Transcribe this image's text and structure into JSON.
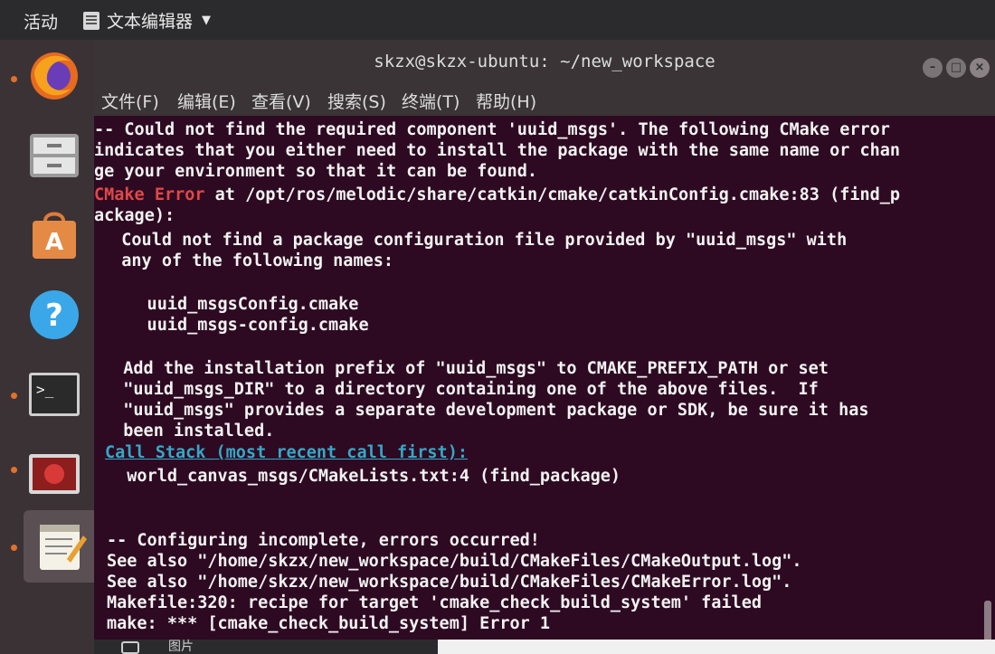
{
  "topbar": {
    "activities": "活动",
    "app_name": "文本编辑器",
    "app_icon": "text-editor-icon",
    "caret_icon": "chevron-down-icon"
  },
  "dock": {
    "items": [
      {
        "name": "firefox",
        "icon": "firefox-icon"
      },
      {
        "name": "files",
        "icon": "file-cabinet-icon"
      },
      {
        "name": "software",
        "icon": "shopping-bag-icon"
      },
      {
        "name": "help",
        "icon": "help-icon"
      },
      {
        "name": "terminal",
        "icon": "terminal-icon"
      },
      {
        "name": "screen-recorder",
        "icon": "red-record-icon"
      },
      {
        "name": "text-editor",
        "icon": "notepad-icon"
      }
    ]
  },
  "terminal": {
    "title": "skzx@skzx-ubuntu: ~/new_workspace",
    "menu": [
      "文件(F)",
      "编辑(E)",
      "查看(V)",
      "搜索(S)",
      "终端(T)",
      "帮助(H)"
    ],
    "colors": {
      "background": "#2d0a22",
      "error": "#e04848",
      "link": "#35a8c6"
    },
    "lines": [
      "-- Could not find the required component 'uuid_msgs'. The following CMake error",
      "indicates that you either need to install the package with the same name or chan",
      "ge your environment so that it can be found.",
      "at /opt/ros/melodic/share/catkin/cmake/catkinConfig.cmake:83 (find_p",
      "ackage):",
      "  Could not find a package configuration file provided by \"uuid_msgs\" with",
      "  any of the following names:",
      "    uuid_msgsConfig.cmake",
      "    uuid_msgs-config.cmake",
      "  Add the installation prefix of \"uuid_msgs\" to CMAKE_PREFIX_PATH or set",
      "  \"uuid_msgs_DIR\" to a directory containing one of the above files.  If",
      "  \"uuid_msgs\" provides a separate development package or SDK, be sure it has",
      "  been installed.",
      "Call Stack (most recent call first):",
      "  world_canvas_msgs/CMakeLists.txt:4 (find_package)",
      "-- Configuring incomplete, errors occurred!",
      "See also \"/home/skzx/new_workspace/build/CMakeFiles/CMakeOutput.log\".",
      "See also \"/home/skzx/new_workspace/build/CMakeFiles/CMakeError.log\".",
      "Makefile:320: recipe for target 'cmake_check_build_system' failed",
      "make: *** [cmake_check_build_system] Error 1"
    ],
    "error_label": "CMake Error"
  },
  "bottom": {
    "label": "图片",
    "icon": "camera-icon"
  }
}
